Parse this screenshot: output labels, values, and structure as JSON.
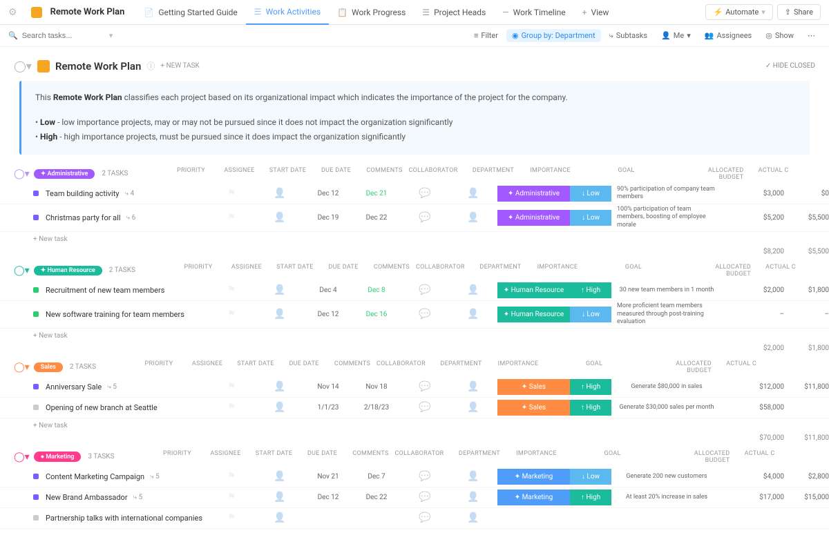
{
  "header": {
    "title": "Remote Work Plan",
    "tabs": [
      {
        "label": "Getting Started Guide",
        "icon": "📄"
      },
      {
        "label": "Work Activities",
        "icon": "☰",
        "active": true
      },
      {
        "label": "Work Progress",
        "icon": "📋"
      },
      {
        "label": "Project Heads",
        "icon": "☰"
      },
      {
        "label": "Work Timeline",
        "icon": "—"
      },
      {
        "label": "View",
        "icon": "+"
      }
    ],
    "automate": "Automate",
    "share": "Share"
  },
  "toolbar": {
    "search_placeholder": "Search tasks...",
    "filter": "Filter",
    "groupby": "Group by: Department",
    "subtasks": "Subtasks",
    "me": "Me",
    "assignees": "Assignees",
    "show": "Show"
  },
  "section": {
    "title": "Remote Work Plan",
    "newtask": "+ NEW TASK",
    "hide_closed": "HIDE CLOSED"
  },
  "desc": {
    "line1a": "This ",
    "line1b": "Remote Work Plan",
    "line1c": " classifies each project based on its organizational impact which indicates the importance of the project for the company.",
    "low_label": "Low",
    "low_text": " - low importance projects, may or may not be pursued since it does not impact the organization significantly",
    "high_label": "High",
    "high_text": " - high importance projects, must be pursued since it does impact the organization significantly"
  },
  "columns": {
    "priority": "PRIORITY",
    "assignee": "ASSIGNEE",
    "startdate": "START DATE",
    "duedate": "DUE DATE",
    "comments": "COMMENTS",
    "collaborator": "COLLABORATOR",
    "department": "DEPARTMENT",
    "importance": "IMPORTANCE",
    "goal": "GOAL",
    "budget": "ALLOCATED BUDGET",
    "actual": "ACTUAL C"
  },
  "newtask_label": "+ New task",
  "colors": {
    "admin_pill": "#a259ff",
    "admin_dept": "#a259ff",
    "hr_pill": "#1abc9c",
    "hr_dept": "#1abc9c",
    "sales_pill": "#ff8c42",
    "sales_dept": "#ff8c42",
    "mkt_pill": "#ff3b8d",
    "mkt_dept": "#4f9cf9",
    "imp_low": "#5bb9f0",
    "imp_high": "#1abc9c",
    "status_purple": "#7b5cff",
    "status_green": "#2ecc71",
    "status_grey": "#ccc"
  },
  "groups": [
    {
      "name": "Administrative",
      "pill_icon": "✦",
      "pill_color": "admin_pill",
      "count": "2 TASKS",
      "caret_color": "#b794f6",
      "dept_color": "admin_dept",
      "tasks": [
        {
          "status": "status_purple",
          "name": "Team building activity",
          "sub": "4",
          "start": "Dec 12",
          "due": "Dec 21",
          "due_green": true,
          "dept": "Administrative",
          "imp": "Low",
          "goal": "90% participation of company team members",
          "budget": "$3,000",
          "actual": "$0"
        },
        {
          "status": "status_purple",
          "name": "Christmas party for all",
          "sub": "6",
          "start": "Dec 19",
          "due": "Dec 22",
          "dept": "Administrative",
          "imp": "Low",
          "goal": "100% participation of team members, boosting of employee morale",
          "budget": "$5,200",
          "actual": "$5,500"
        }
      ],
      "tot_budget": "$8,200",
      "tot_actual": "$5,500"
    },
    {
      "name": "Human Resource",
      "pill_icon": "✦",
      "pill_color": "hr_pill",
      "count": "2 TASKS",
      "caret_color": "#1abc9c",
      "dept_color": "hr_dept",
      "tasks": [
        {
          "status": "status_green",
          "name": "Recruitment of new team members",
          "start": "Dec 4",
          "due": "Dec 8",
          "due_green": true,
          "dept": "Human Resource",
          "imp": "High",
          "goal": "30 new team members in 1 month",
          "budget": "$2,000",
          "actual": "$1,800"
        },
        {
          "status": "status_green",
          "name": "New software training for team members",
          "start": "Dec 12",
          "due": "Dec 16",
          "due_green": true,
          "dept": "Human Resource",
          "imp": "Low",
          "goal": "More proficient team members measured through post-training evaluation",
          "budget": "–",
          "actual": "–"
        }
      ],
      "tot_budget": "$2,000",
      "tot_actual": "$1,800"
    },
    {
      "name": "Sales",
      "pill_icon": "",
      "pill_color": "sales_pill",
      "count": "2 TASKS",
      "caret_color": "#ff8c42",
      "dept_color": "sales_dept",
      "tasks": [
        {
          "status": "status_purple",
          "name": "Anniversary Sale",
          "sub": "5",
          "start": "Nov 14",
          "due": "Nov 18",
          "dept": "Sales",
          "imp": "High",
          "goal": "Generate $80,000 in sales",
          "budget": "$12,000",
          "actual": "$11,800"
        },
        {
          "status": "status_grey",
          "name": "Opening of new branch at Seattle",
          "start": "1/1/23",
          "due": "2/18/23",
          "dept": "Sales",
          "imp": "High",
          "goal": "Generate $30,000 sales per month",
          "budget": "$58,000",
          "actual": ""
        }
      ],
      "tot_budget": "$70,000",
      "tot_actual": "$11,800"
    },
    {
      "name": "Marketing",
      "pill_icon": "●",
      "pill_color": "mkt_pill",
      "count": "3 TASKS",
      "caret_color": "#ff3b8d",
      "dept_color": "mkt_dept",
      "no_newtask": true,
      "tasks": [
        {
          "status": "status_purple",
          "name": "Content Marketing Campaign",
          "sub": "5",
          "start": "Nov 21",
          "due": "Dec 7",
          "dept": "Marketing",
          "imp": "Low",
          "goal": "Generate 200 new customers",
          "budget": "$4,000",
          "actual": "$2,800"
        },
        {
          "status": "status_purple",
          "name": "New Brand Ambassador",
          "sub": "5",
          "start": "Dec 12",
          "due": "Dec 22",
          "dept": "Marketing",
          "imp": "High",
          "goal": "At least 20% increase in sales",
          "budget": "$17,000",
          "actual": "$15,000"
        },
        {
          "status": "status_grey",
          "name": "Partnership talks with international companies",
          "start": "",
          "due": "",
          "dept": "",
          "imp": "",
          "goal": "",
          "budget": "",
          "actual": ""
        }
      ]
    }
  ]
}
